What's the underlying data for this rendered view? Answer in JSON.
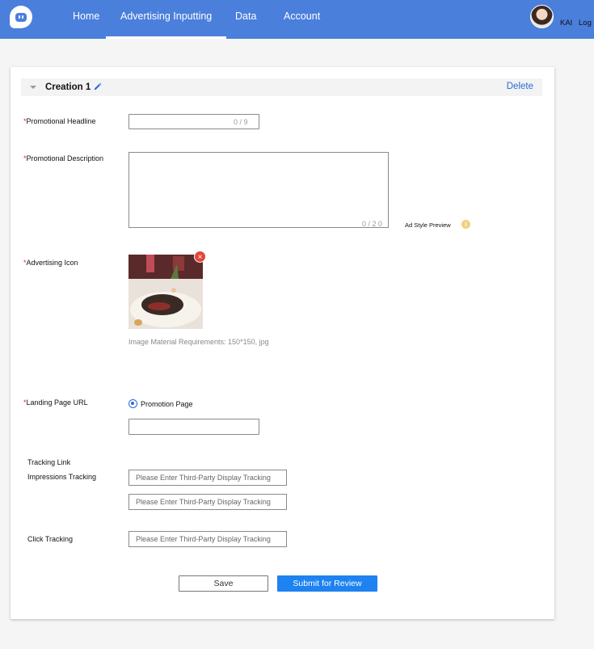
{
  "nav": {
    "items": [
      {
        "label": "Home",
        "active": false
      },
      {
        "label": "Advertising Inputting",
        "active": true
      },
      {
        "label": "Data",
        "active": false
      },
      {
        "label": "Account",
        "active": false
      }
    ],
    "user_name": "KAI",
    "logout_label": "Log"
  },
  "creation": {
    "title": "Creation 1",
    "delete_label": "Delete"
  },
  "form": {
    "headline": {
      "label": "Promotional Headline",
      "value": "",
      "counter": "0 / 9"
    },
    "description": {
      "label": "Promotional Description",
      "value": "",
      "counter": "0 / 2 0"
    },
    "ad_style_preview": "Ad Style Preview",
    "icon": {
      "label": "Advertising Icon",
      "requirements": "Image Material Requirements: 150*150, jpg"
    },
    "landing": {
      "label": "Landing Page URL",
      "option": "Promotion Page",
      "value": ""
    },
    "tracking": {
      "section_label": "Tracking Link",
      "impressions_label": "Impressions Tracking",
      "click_label": "Click Tracking",
      "placeholder": "Please Enter Third-Party Display Tracking"
    }
  },
  "actions": {
    "save_label": "Save",
    "submit_label": "Submit for Review"
  },
  "colors": {
    "topbar": "#4a7fdc",
    "accent": "#2a6ad8",
    "submit": "#1e82f0",
    "required": "#d0312d"
  }
}
